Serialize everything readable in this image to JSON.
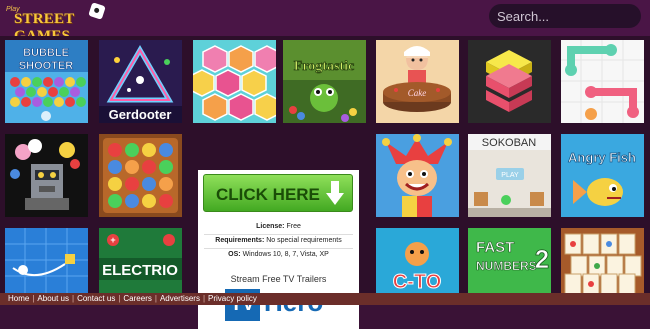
{
  "header": {
    "logo_small": "Play",
    "logo_text": "STREET GAMES",
    "search_placeholder": "Search..."
  },
  "tiles": [
    {
      "label": "Bubble Shooter"
    },
    {
      "label": "Gerdooter"
    },
    {
      "label": "Hexa"
    },
    {
      "label": "Frogtastic"
    },
    {
      "label": "Cake Design"
    },
    {
      "label": "Stack"
    },
    {
      "label": "Connect Dots"
    },
    {
      "label": "Robot Puzzle"
    },
    {
      "label": "Marbles"
    },
    {
      "label": "Jester"
    },
    {
      "label": "SOKOBAN",
      "play": "PLAY"
    },
    {
      "label": "Angry Fish"
    },
    {
      "label": "Physics"
    },
    {
      "label": "ELECTRIO"
    },
    {
      "label": "C-TO"
    },
    {
      "label": "FAST NUMBERS",
      "number": "2"
    },
    {
      "label": "Mahjong"
    }
  ],
  "ad": {
    "button_label": "CLICK HERE",
    "license_label": "License:",
    "license_value": "Free",
    "requirements_label": "Requirements:",
    "requirements_value": "No special requirements",
    "os_label": "OS:",
    "os_value": "Windows 10, 8, 7, Vista, XP",
    "stream_text": "Stream Free TV Trailers",
    "brand_tv": "TV",
    "brand_hero": "Hero"
  },
  "footer": {
    "links": [
      "Home",
      "About us",
      "Contact us",
      "Careers",
      "Advertisers",
      "Privacy policy"
    ]
  },
  "colors": {
    "header_bg": "#4a1546",
    "footer_bg": "#6b2e2a",
    "accent": "#1569b4",
    "cta_green": "#43a922"
  }
}
